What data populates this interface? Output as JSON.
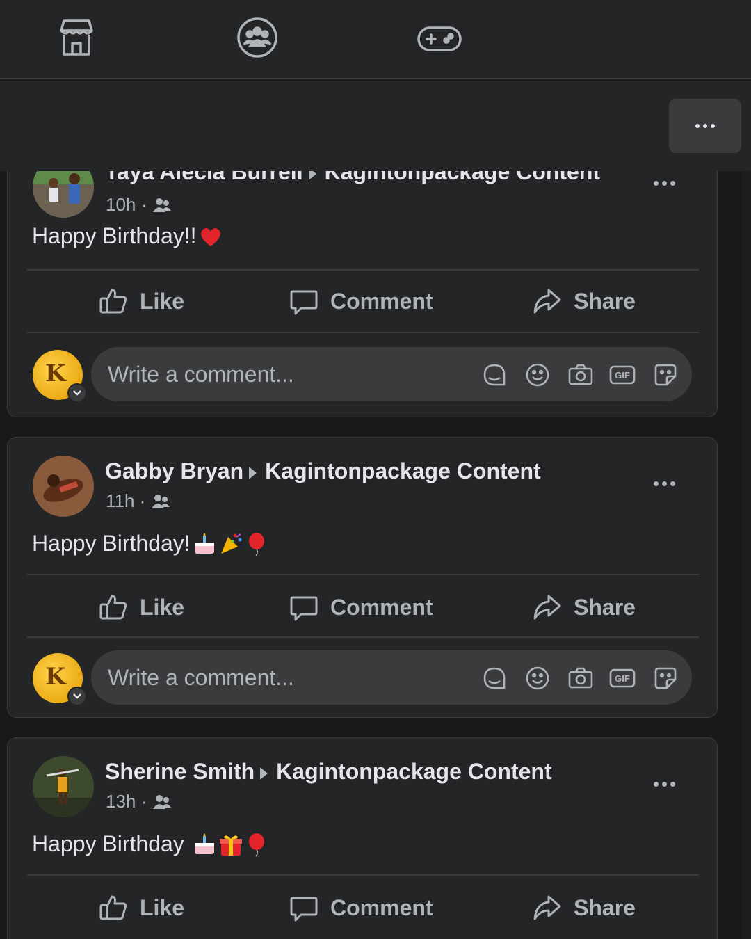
{
  "nav": {
    "icons": [
      "marketplace-icon",
      "groups-icon",
      "gaming-icon"
    ]
  },
  "posts": [
    {
      "name": "Taya Alecia Burrell",
      "group": "Kagintonpackage Content",
      "time": "10h ·",
      "text": "Happy Birthday!!",
      "emojis": [
        "red-heart"
      ]
    },
    {
      "name": "Gabby Bryan",
      "group": "Kagintonpackage Content",
      "time": "11h ·",
      "text": "Happy Birthday!",
      "emojis": [
        "birthday-cake",
        "party-popper",
        "balloon"
      ]
    },
    {
      "name": "Sherine Smith",
      "group": "Kagintonpackage Content",
      "time": "13h ·",
      "text": "Happy Birthday ",
      "emojis": [
        "birthday-cake",
        "wrapped-gift",
        "balloon"
      ]
    }
  ],
  "actions": {
    "like": "Like",
    "comment": "Comment",
    "share": "Share"
  },
  "composer": {
    "placeholder": "Write a comment...",
    "gif_label": "GIF"
  },
  "colors": {
    "background": "#18191a",
    "surface": "#242526",
    "input": "#3a3b3c",
    "text_primary": "#e4e6eb",
    "text_secondary": "#b0b3b8"
  }
}
